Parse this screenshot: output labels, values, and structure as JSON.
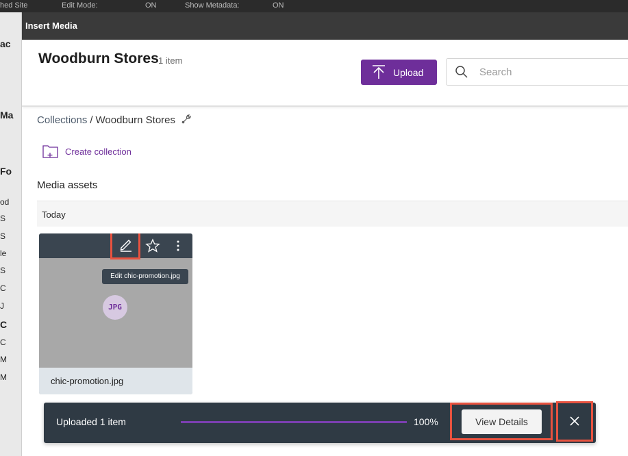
{
  "background": {
    "topbar_items": [
      "hed Site",
      "Edit Mode:",
      "ON",
      "Show Metadata:",
      "ON"
    ],
    "sidebar_fragments": [
      "ac",
      "Ma",
      "Fo",
      "od",
      "S",
      "S",
      "le",
      "S",
      "C",
      "J",
      "C",
      "C",
      "M",
      "M"
    ]
  },
  "modal": {
    "title": "Insert Media"
  },
  "toolbar": {
    "collection_title": "Woodburn Stores",
    "item_count": "1 item",
    "upload_label": "Upload",
    "search_placeholder": "Search",
    "upload_icon": "upload-arrow-icon",
    "search_icon": "magnifier-icon"
  },
  "breadcrumb": {
    "root": "Collections",
    "separator": "/",
    "current": "Woodburn Stores",
    "edit_icon": "wrench-icon"
  },
  "create_collection": {
    "label": "Create collection",
    "icon": "folder-plus-icon"
  },
  "section": {
    "title": "Media assets",
    "group_label": "Today"
  },
  "asset": {
    "filename": "chic-promotion.jpg",
    "type_badge": "JPG",
    "tooltip": "Edit chic-promotion.jpg",
    "actions": [
      "edit-pencil-icon",
      "star-icon",
      "more-vertical-icon"
    ]
  },
  "upload_toast": {
    "message": "Uploaded 1 item",
    "progress": 1.0,
    "progress_label": "100%",
    "view_details_label": "View Details",
    "close_icon": "close-icon"
  },
  "colors": {
    "accent": "#6e2e9a",
    "header": "#3a3a3a",
    "toast": "#2f3a44",
    "highlight": "#e8523f"
  }
}
